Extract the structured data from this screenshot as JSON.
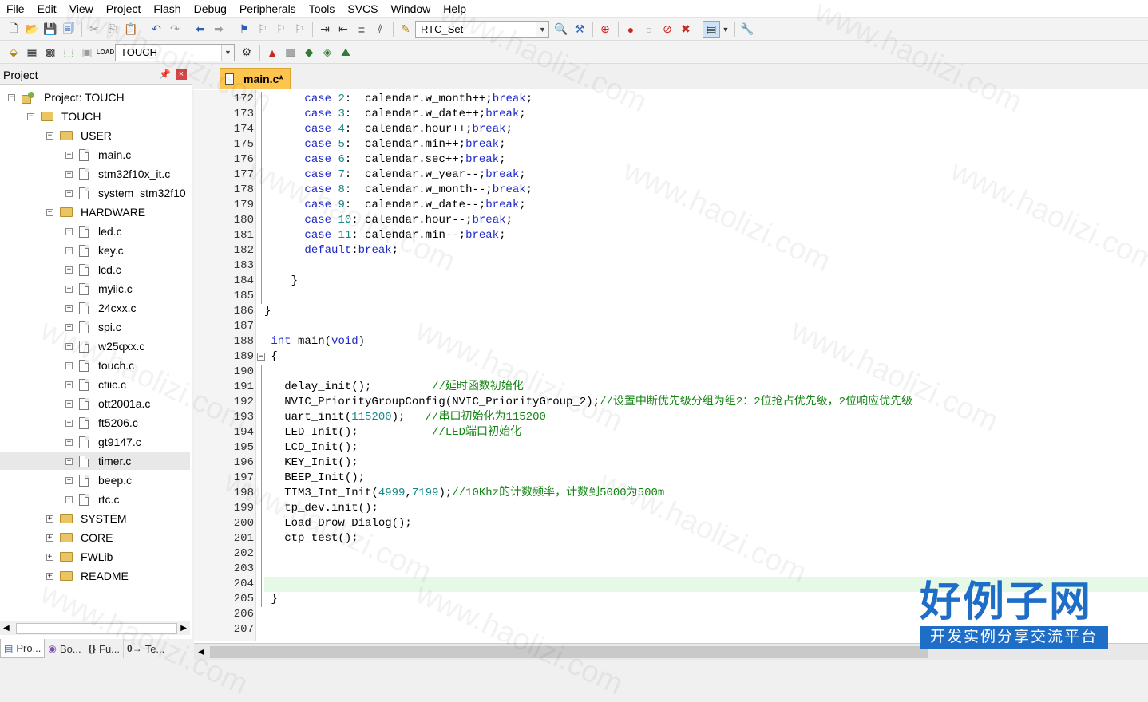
{
  "menu": [
    "File",
    "Edit",
    "View",
    "Project",
    "Flash",
    "Debug",
    "Peripherals",
    "Tools",
    "SVCS",
    "Window",
    "Help"
  ],
  "toolbar1": {
    "target_combo": "RTC_Set"
  },
  "toolbar2": {
    "build_combo": "TOUCH",
    "load_label": "LOAD"
  },
  "project_panel": {
    "title": "Project",
    "tree": [
      {
        "label": "Project: TOUCH",
        "type": "project",
        "depth": 0,
        "expander": "−"
      },
      {
        "label": "TOUCH",
        "type": "target",
        "depth": 1,
        "expander": "−"
      },
      {
        "label": "USER",
        "type": "folder",
        "depth": 2,
        "expander": "−"
      },
      {
        "label": "main.c",
        "type": "file",
        "depth": 3,
        "expander": "+"
      },
      {
        "label": "stm32f10x_it.c",
        "type": "file",
        "depth": 3,
        "expander": "+"
      },
      {
        "label": "system_stm32f10",
        "type": "file",
        "depth": 3,
        "expander": "+"
      },
      {
        "label": "HARDWARE",
        "type": "folder",
        "depth": 2,
        "expander": "−"
      },
      {
        "label": "led.c",
        "type": "file",
        "depth": 3,
        "expander": "+"
      },
      {
        "label": "key.c",
        "type": "file",
        "depth": 3,
        "expander": "+"
      },
      {
        "label": "lcd.c",
        "type": "file",
        "depth": 3,
        "expander": "+"
      },
      {
        "label": "myiic.c",
        "type": "file",
        "depth": 3,
        "expander": "+"
      },
      {
        "label": "24cxx.c",
        "type": "file",
        "depth": 3,
        "expander": "+"
      },
      {
        "label": "spi.c",
        "type": "file",
        "depth": 3,
        "expander": "+"
      },
      {
        "label": "w25qxx.c",
        "type": "file",
        "depth": 3,
        "expander": "+"
      },
      {
        "label": "touch.c",
        "type": "file",
        "depth": 3,
        "expander": "+"
      },
      {
        "label": "ctiic.c",
        "type": "file",
        "depth": 3,
        "expander": "+"
      },
      {
        "label": "ott2001a.c",
        "type": "file",
        "depth": 3,
        "expander": "+"
      },
      {
        "label": "ft5206.c",
        "type": "file",
        "depth": 3,
        "expander": "+"
      },
      {
        "label": "gt9147.c",
        "type": "file",
        "depth": 3,
        "expander": "+"
      },
      {
        "label": "timer.c",
        "type": "file",
        "depth": 3,
        "expander": "+",
        "selected": true
      },
      {
        "label": "beep.c",
        "type": "file",
        "depth": 3,
        "expander": "+"
      },
      {
        "label": "rtc.c",
        "type": "file",
        "depth": 3,
        "expander": "+"
      },
      {
        "label": "SYSTEM",
        "type": "folder",
        "depth": 2,
        "expander": "+"
      },
      {
        "label": "CORE",
        "type": "folder",
        "depth": 2,
        "expander": "+"
      },
      {
        "label": "FWLib",
        "type": "folder",
        "depth": 2,
        "expander": "+"
      },
      {
        "label": "README",
        "type": "folder",
        "depth": 2,
        "expander": "+"
      }
    ],
    "bottom_tabs": [
      {
        "label": "Pro...",
        "icon": "project-icon"
      },
      {
        "label": "Bo...",
        "icon": "books-icon"
      },
      {
        "label": "Fu...",
        "icon": "functions-icon",
        "glyph": "{}"
      },
      {
        "label": "Te...",
        "icon": "templates-icon",
        "glyph": "0→"
      }
    ]
  },
  "editor": {
    "tab_label": "main.c*",
    "current_line": 204,
    "lines": [
      {
        "n": 172,
        "html": "      <span class=\"kw\">case</span> <span class=\"num\">2</span>:  calendar.w_month++;<span class=\"kw\">break</span>;"
      },
      {
        "n": 173,
        "html": "      <span class=\"kw\">case</span> <span class=\"num\">3</span>:  calendar.w_date++;<span class=\"kw\">break</span>;"
      },
      {
        "n": 174,
        "html": "      <span class=\"kw\">case</span> <span class=\"num\">4</span>:  calendar.hour++;<span class=\"kw\">break</span>;"
      },
      {
        "n": 175,
        "html": "      <span class=\"kw\">case</span> <span class=\"num\">5</span>:  calendar.min++;<span class=\"kw\">break</span>;"
      },
      {
        "n": 176,
        "html": "      <span class=\"kw\">case</span> <span class=\"num\">6</span>:  calendar.sec++;<span class=\"kw\">break</span>;"
      },
      {
        "n": 177,
        "html": "      <span class=\"kw\">case</span> <span class=\"num\">7</span>:  calendar.w_year--;<span class=\"kw\">break</span>;"
      },
      {
        "n": 178,
        "html": "      <span class=\"kw\">case</span> <span class=\"num\">8</span>:  calendar.w_month--;<span class=\"kw\">break</span>;"
      },
      {
        "n": 179,
        "html": "      <span class=\"kw\">case</span> <span class=\"num\">9</span>:  calendar.w_date--;<span class=\"kw\">break</span>;"
      },
      {
        "n": 180,
        "html": "      <span class=\"kw\">case</span> <span class=\"num\">10</span>: calendar.hour--;<span class=\"kw\">break</span>;"
      },
      {
        "n": 181,
        "html": "      <span class=\"kw\">case</span> <span class=\"num\">11</span>: calendar.min--;<span class=\"kw\">break</span>;"
      },
      {
        "n": 182,
        "html": "      <span class=\"kw\">default</span>:<span class=\"kw\">break</span>;"
      },
      {
        "n": 183,
        "html": ""
      },
      {
        "n": 184,
        "html": "    }"
      },
      {
        "n": 185,
        "html": ""
      },
      {
        "n": 186,
        "html": "}"
      },
      {
        "n": 187,
        "html": ""
      },
      {
        "n": 188,
        "html": " <span class=\"kw\">int</span> main(<span class=\"kw\">void</span>)"
      },
      {
        "n": 189,
        "html": " {"
      },
      {
        "n": 190,
        "html": ""
      },
      {
        "n": 191,
        "html": "   delay_init();         <span class=\"cm\">//延时函数初始化</span>"
      },
      {
        "n": 192,
        "html": "   NVIC_PriorityGroupConfig(NVIC_PriorityGroup_2);<span class=\"cm\">//设置中断优先级分组为组2：2位抢占优先级，2位响应优先级</span>"
      },
      {
        "n": 193,
        "html": "   uart_init(<span class=\"num\">115200</span>);   <span class=\"cm\">//串口初始化为115200</span>"
      },
      {
        "n": 194,
        "html": "   LED_Init();           <span class=\"cm\">//LED端口初始化</span>"
      },
      {
        "n": 195,
        "html": "   LCD_Init();"
      },
      {
        "n": 196,
        "html": "   KEY_Init();"
      },
      {
        "n": 197,
        "html": "   BEEP_Init();"
      },
      {
        "n": 198,
        "html": "   TIM3_Int_Init(<span class=\"num\">4999</span>,<span class=\"num\">7199</span>);<span class=\"cm\">//10Khz的计数频率，计数到5000为500m</span>"
      },
      {
        "n": 199,
        "html": "   tp_dev.init();"
      },
      {
        "n": 200,
        "html": "   Load_Drow_Dialog();"
      },
      {
        "n": 201,
        "html": "   ctp_test();"
      },
      {
        "n": 202,
        "html": ""
      },
      {
        "n": 203,
        "html": ""
      },
      {
        "n": 204,
        "html": ""
      },
      {
        "n": 205,
        "html": " }"
      },
      {
        "n": 206,
        "html": ""
      },
      {
        "n": 207,
        "html": ""
      }
    ]
  },
  "watermark": {
    "text": "www.haolizi.com",
    "logo_main": "好例子网",
    "logo_sub": "开发实例分享交流平台",
    "color": "#1e6ec8"
  }
}
